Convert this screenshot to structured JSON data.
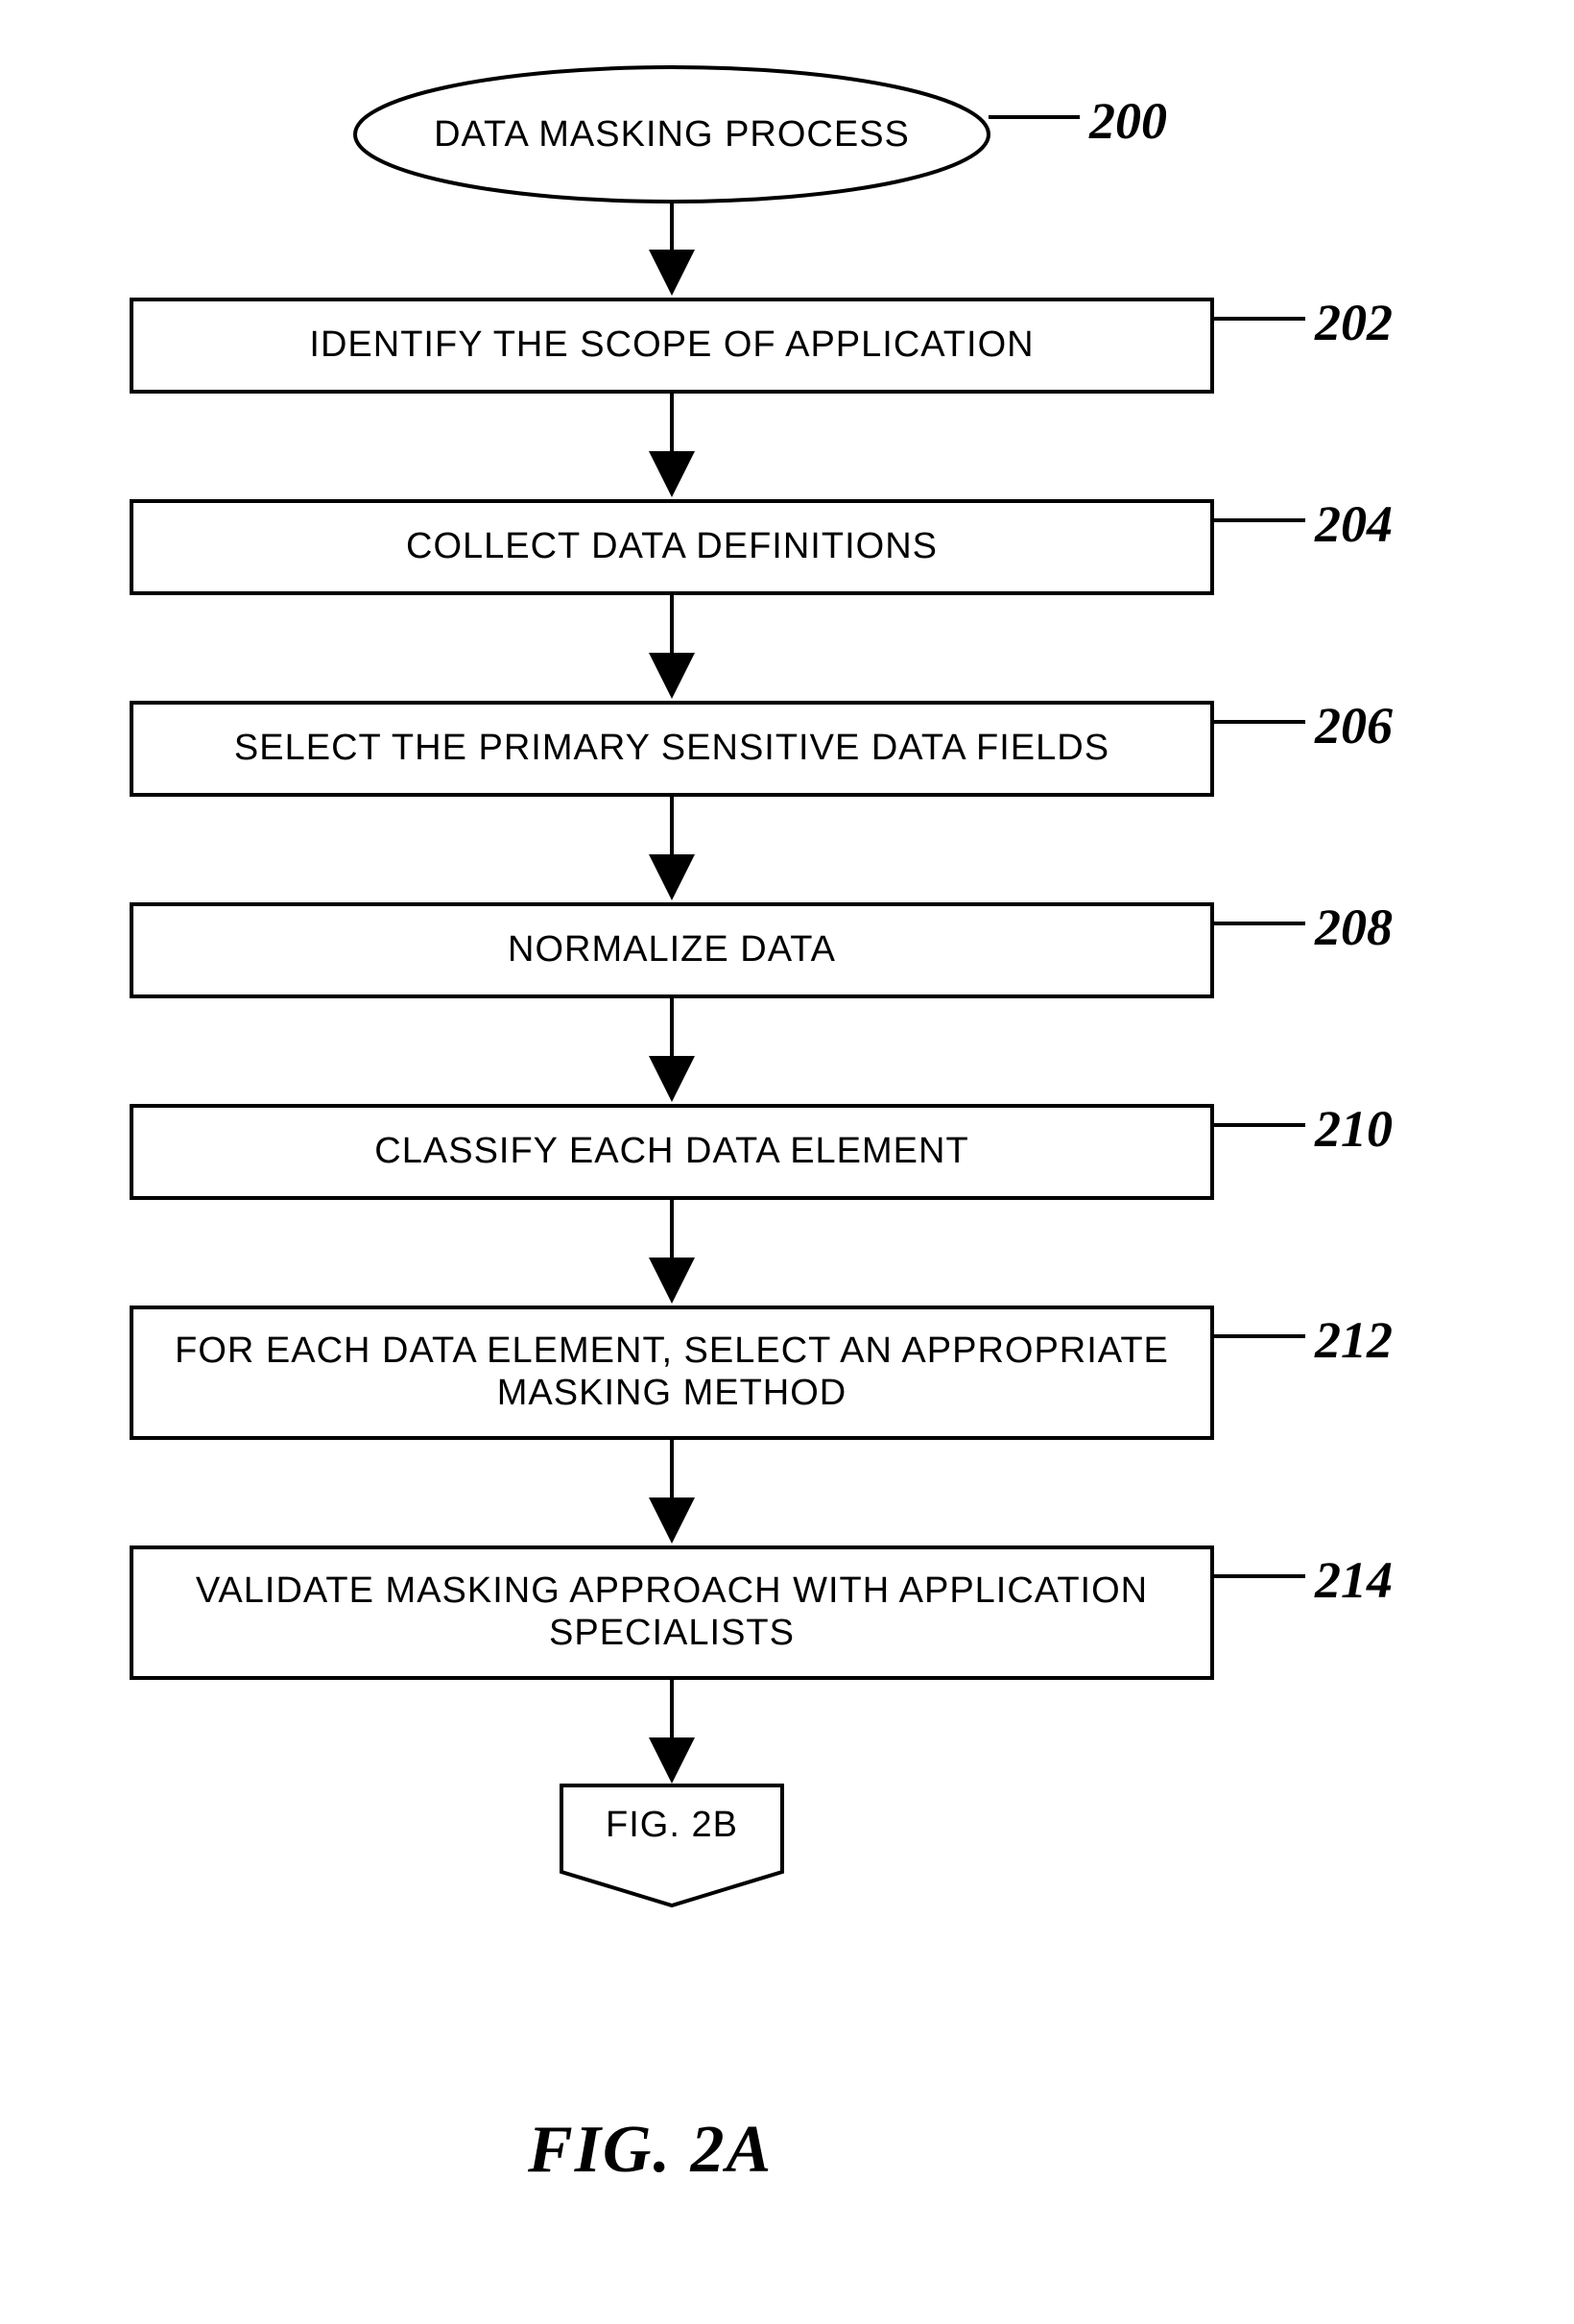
{
  "start": {
    "label": "DATA MASKING PROCESS",
    "ref": "200"
  },
  "steps": [
    {
      "label": "IDENTIFY THE SCOPE OF APPLICATION",
      "ref": "202"
    },
    {
      "label": "COLLECT DATA DEFINITIONS",
      "ref": "204"
    },
    {
      "label": "SELECT THE PRIMARY SENSITIVE DATA FIELDS",
      "ref": "206"
    },
    {
      "label": "NORMALIZE DATA",
      "ref": "208"
    },
    {
      "label": "CLASSIFY EACH DATA ELEMENT",
      "ref": "210"
    },
    {
      "label": "FOR EACH DATA ELEMENT, SELECT AN APPROPRIATE MASKING METHOD",
      "ref": "212"
    },
    {
      "label": "VALIDATE MASKING APPROACH WITH APPLICATION SPECIALISTS",
      "ref": "214"
    }
  ],
  "connector": {
    "label": "FIG. 2B"
  },
  "caption": "FIG.  2A"
}
